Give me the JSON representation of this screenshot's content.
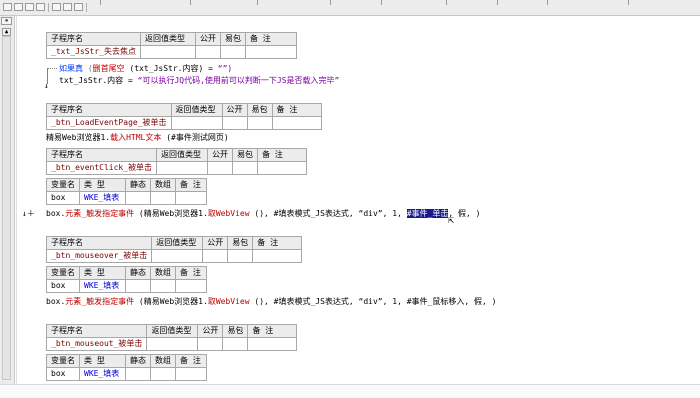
{
  "sub_header": {
    "name": "子程序名",
    "ret": "返回值类型",
    "pub": "公开",
    "easy": "易包",
    "note": "备 注"
  },
  "var_header": {
    "name": "变量名",
    "type": "类 型",
    "static": "静态",
    "array": "数组",
    "note": "备 注"
  },
  "block1": {
    "sub_name": "_txt_JsStr_失去焦点",
    "if_keyword": "如果真",
    "if_func": "删首尾空",
    "if_arg": "(txt_JsStr.内容)",
    "if_eq": "=",
    "if_val": "“”)",
    "assign_target": "txt_JsStr.内容",
    "assign_eq": "=",
    "assign_value": "“可以执行JQ代码,使用前可以判断一下JS是否载入完毕”"
  },
  "block2": {
    "sub_name": "_btn_LoadEventPage_被单击",
    "line_obj": "精易Web浏览器1.",
    "line_method": "载入HTML文本",
    "line_arg": "(#事件测试网页)"
  },
  "block3": {
    "sub_name": "_btn_eventClick_被单击",
    "var_name": "box",
    "var_type": "WKE_填表",
    "call_prefix": "box.",
    "call_method": "元素_触发指定事件",
    "call_args_a": "(精易Web浏览器1.",
    "call_method2": "取WebView",
    "call_args_b": "(), #填表模式_JS表达式, “div”, 1,",
    "call_selected": "#事件_单击",
    "call_args_c": ", 假, )"
  },
  "block4": {
    "sub_name": "_btn_mouseover_被单击",
    "var_name": "box",
    "var_type": "WKE_填表",
    "call_prefix": "box.",
    "call_method": "元素_触发指定事件",
    "call_args_a": "(精易Web浏览器1.",
    "call_method2": "取WebView",
    "call_args_b": "(), #填表模式_JS表达式, “div”, 1, #事件_鼠标移入, 假, )"
  },
  "block5": {
    "sub_name": "_btn_mouseout_被单击",
    "var_name": "box",
    "var_type": "WKE_填表"
  },
  "marker": "↓＋",
  "colors": {
    "keyword": "#003cff",
    "function": "#c00000",
    "string": "#7a00a0",
    "selection": "#1a1a8e"
  }
}
